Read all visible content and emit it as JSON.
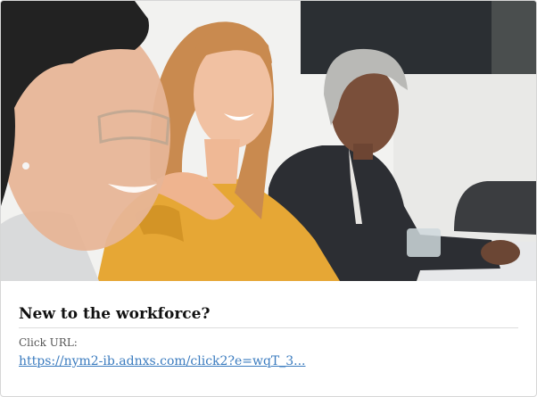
{
  "ad": {
    "title": "New to the workforce?",
    "click_url_label": "Click URL:",
    "click_url_text": "https://nym2-ib.adnxs.com/click2?e=wqT_3..."
  },
  "colors": {
    "link": "#3a7bbf",
    "title": "#111111",
    "border": "#d6d6d6"
  }
}
